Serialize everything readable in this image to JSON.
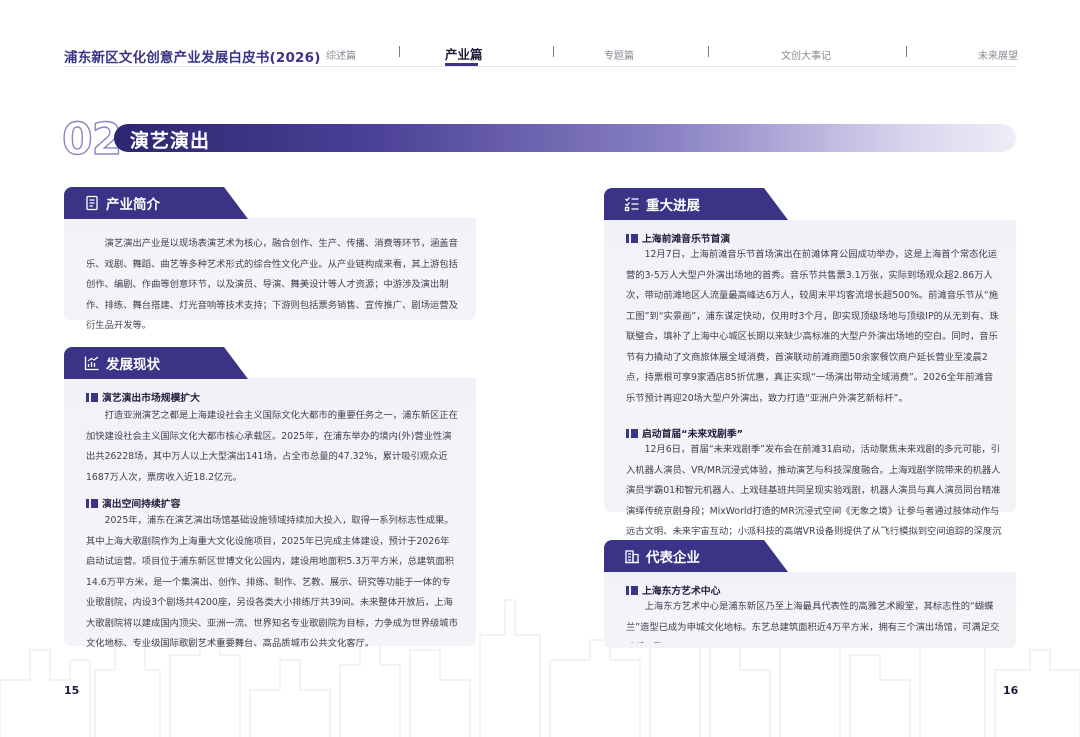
{
  "header": {
    "doc_title": "浦东新区文化创意产业发展白皮书(2026)",
    "nav": [
      "综述篇",
      "产业篇",
      "专题篇",
      "文创大事记",
      "未来展望"
    ],
    "active_index": 1
  },
  "section": {
    "number": "02",
    "title": "演艺演出"
  },
  "intro": {
    "tab_label": "产业简介",
    "icon": "document-icon",
    "text": "演艺演出产业是以现场表演艺术为核心，融合创作、生产、传播、消费等环节，涵盖音乐、戏剧、舞蹈、曲艺等多种艺术形式的综合性文化产业。从产业链构成来看，其上游包括创作、编剧、作曲等创意环节，以及演员、导演、舞美设计等人才资源；中游涉及演出制作、排练、舞台搭建、灯光音响等技术支持；下游则包括票务销售、宣传推广、剧场运营及衍生品开发等。"
  },
  "status": {
    "tab_label": "发展现状",
    "icon": "chart-icon",
    "items": [
      {
        "heading": "演艺演出市场规模扩大",
        "text": "打造亚洲演艺之都是上海建设社会主义国际文化大都市的重要任务之一，浦东新区正在加快建设社会主义国际文化大都市核心承载区。2025年，在浦东举办的境内(外)营业性演出共26228场，其中万人以上大型演出141场，占全市总量的47.32%，累计吸引观众近1687万人次，票房收入近18.2亿元。"
      },
      {
        "heading": "演出空间持续扩容",
        "text": "2025年，浦东在演艺演出场馆基础设施领域持续加大投入，取得一系列标志性成果。其中上海大歌剧院作为上海重大文化设施项目，2025年已完成主体建设，预计于2026年启动试运营。项目位于浦东新区世博文化公园内，建设用地面积5.3万平方米，总建筑面积14.6万平方米，是一个集演出、创作、排练、制作、艺教、展示、研究等功能于一体的专业歌剧院，内设3个剧场共4200座，另设各类大小排练厅共39间。未来整体开放后，上海大歌剧院将以建成国内顶尖、亚洲一流、世界知名专业歌剧院为目标，力争成为世界级城市文化地标、专业级国际歌剧艺术重要舞台、高品质城市公共文化客厅。"
      }
    ]
  },
  "progress": {
    "tab_label": "重大进展",
    "icon": "checklist-icon",
    "items": [
      {
        "heading": "上海前滩音乐节首演",
        "text": "12月7日，上海前滩音乐节首场演出在前滩体育公园成功举办，这是上海首个常态化运营的3-5万人大型户外演出场地的首秀。音乐节共售票3.1万张，实际到场观众超2.86万人次，带动前滩地区人流量最高峰达6万人，较周末平均客流增长超500%。前滩音乐节从“施工图”到“实景画”，浦东谋定快动，仅用时3个月，即实现顶级场地与顶级IP的从无到有、珠联璧合，填补了上海中心城区长期以来缺少高标准的大型户外演出场地的空白。同时，音乐节有力撬动了文商旅体展全域消费，首演联动前滩商圈50余家餐饮商户延长营业至凌晨2点，持票根可享9家酒店85折优惠，真正实现“一场演出带动全域消费”。2026全年前滩音乐节预计再迎20场大型户外演出，致力打造“亚洲户外演艺新标杆”。"
      },
      {
        "heading": "启动首届“未来戏剧季”",
        "text": "12月6日，首届“未来戏剧季”发布会在前滩31启动，活动聚焦未来戏剧的多元可能，引入机器人演员、VR/MR沉浸式体验，推动演艺与科技深度融合。上海戏剧学院带来的机器人演员学霸01和智元机器人、上戏硅基班共同呈现实验戏剧，机器人演员与真人演员同台精准演绎传统京剧身段；MixWorld打造的MR沉浸式空间《无象之境》让参与者通过肢体动作与远古文明、未来宇宙互动；小派科技的高端VR设备则提供了从飞行模拟到空间追踪的深度沉浸体验。"
      }
    ]
  },
  "companies": {
    "tab_label": "代表企业",
    "icon": "building-icon",
    "items": [
      {
        "heading": "上海东方艺术中心",
        "text": "上海东方艺术中心是浦东新区乃至上海最具代表性的高雅艺术殿堂，其标志性的“蝴蝶兰”造型已成为申城文化地标。东艺总建筑面积近4万平方米，拥有三个演出场馆，可满足交响乐、歌"
      }
    ]
  },
  "page_numbers": {
    "left": "15",
    "right": "16"
  },
  "colors": {
    "brand": "#3b3486",
    "card_bg": "#f3f2f8"
  }
}
